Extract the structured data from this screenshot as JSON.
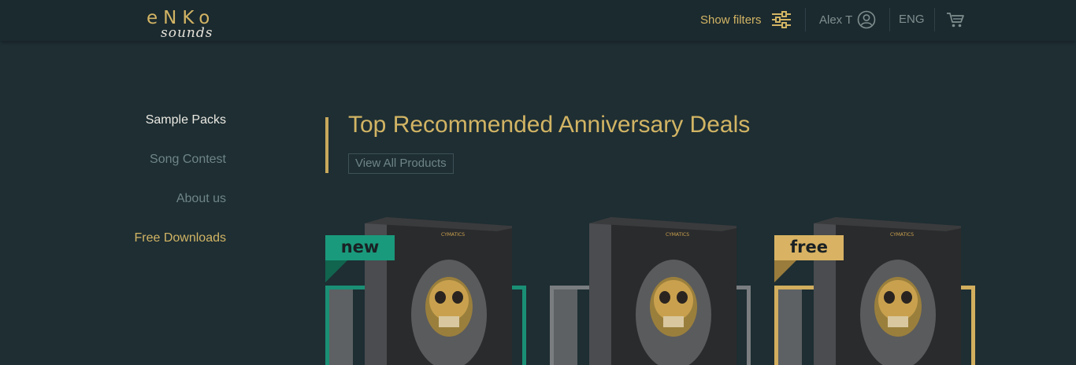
{
  "brand": {
    "logo_top": "eNKo",
    "logo_script": "sounds"
  },
  "header": {
    "filters_label": "Show filters",
    "user_name": "Alex T",
    "language": "ENG"
  },
  "nav": {
    "items": [
      {
        "label": "Sample Packs"
      },
      {
        "label": "Song Contest"
      },
      {
        "label": "About us"
      },
      {
        "label": "Free Downloads"
      }
    ]
  },
  "section": {
    "title": "Top Recommended Anniversary Deals",
    "view_all": "View All Products"
  },
  "products": [
    {
      "badge": "new",
      "frame_color": "#1a8f75",
      "box_brand": "CYMATICS"
    },
    {
      "badge": "",
      "frame_color": "#7a7d80",
      "box_brand": "CYMATICS"
    },
    {
      "badge": "free",
      "frame_color": "#d2ae5e",
      "box_brand": "CYMATICS"
    }
  ],
  "colors": {
    "background": "#1e2e33",
    "header": "#1b2a2f",
    "accent_gold": "#d2b464",
    "accent_teal": "#1a9a7c",
    "muted_text": "#6f8587"
  },
  "icons": [
    "filters-icon",
    "user-icon",
    "cart-icon",
    "skull-artwork"
  ]
}
